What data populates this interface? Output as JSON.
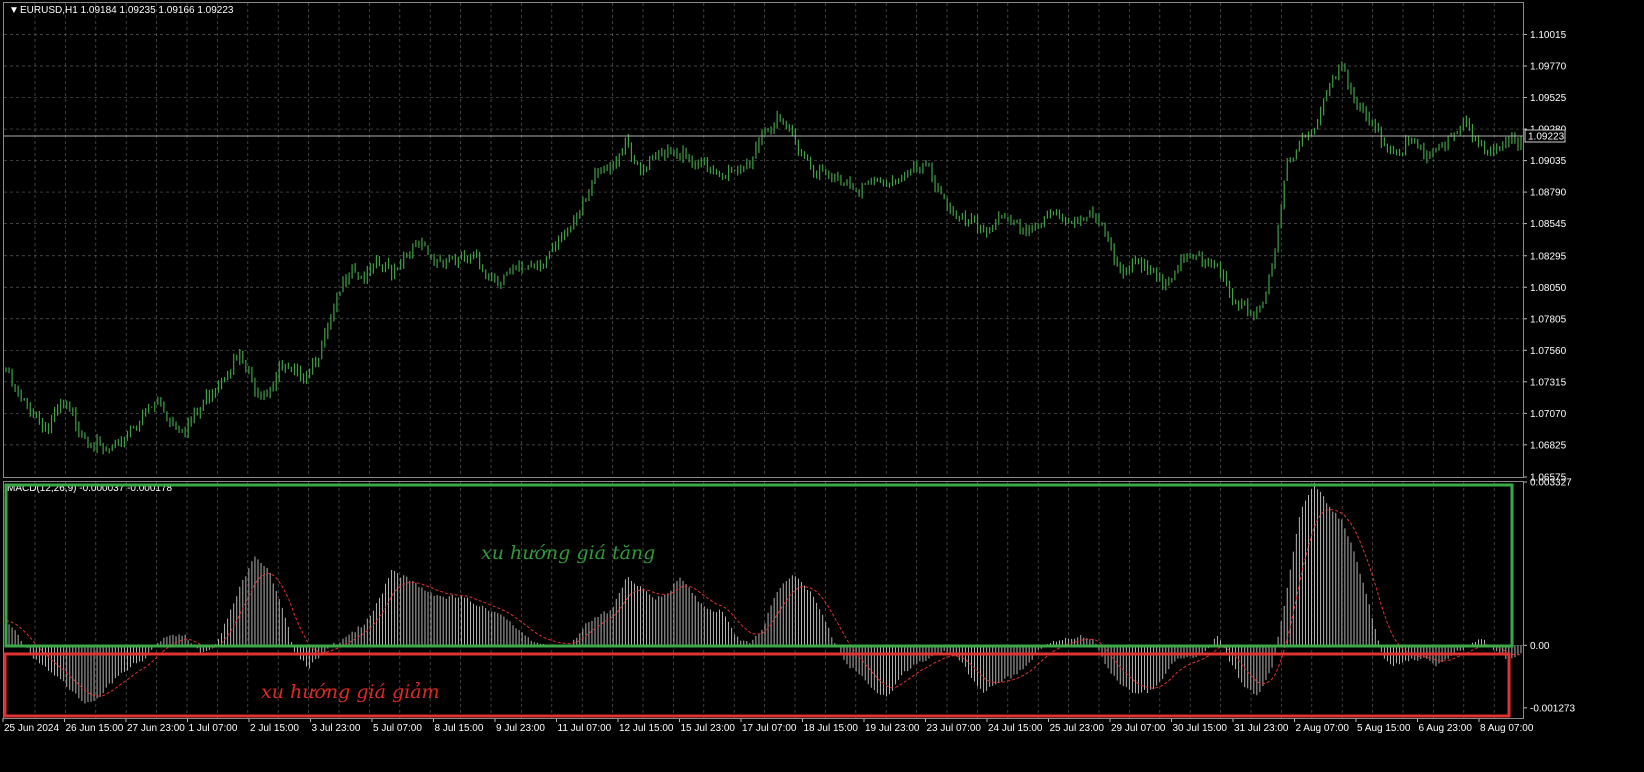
{
  "symbol_header": "EURUSD,H1  1.09184 1.09235 1.09166 1.09223",
  "current_price_label": "1.09223",
  "macd_header": "MACD(12,26,9) -0.000037 -0.000178",
  "annotations": {
    "up_label": "xu hướng giá tăng",
    "down_label": "xu hướng giá giảm"
  },
  "colors": {
    "background": "#000000",
    "candles": "#3fa046",
    "macd_hist": "#c8c8c8",
    "signal": "#e03030",
    "up_box": "#3aa848",
    "down_box": "#e03232",
    "grid": "#5a5a5a"
  },
  "chart_data": [
    {
      "type": "line",
      "name": "EURUSD,H1",
      "grid": true,
      "ylim": [
        1.06575,
        1.1026
      ],
      "y_ticks": [
        "1.10015",
        "1.09770",
        "1.09525",
        "1.09280",
        "1.09035",
        "1.08790",
        "1.08545",
        "1.08295",
        "1.08050",
        "1.07805",
        "1.07560",
        "1.07315",
        "1.07070",
        "1.06825",
        "1.06575"
      ],
      "x_ticks": [
        "25 Jun 2024",
        "26 Jun 15:00",
        "27 Jun 23:00",
        "1 Jul 07:00",
        "2 Jul 15:00",
        "3 Jul 23:00",
        "5 Jul 07:00",
        "8 Jul 15:00",
        "9 Jul 23:00",
        "11 Jul 07:00",
        "12 Jul 15:00",
        "15 Jul 23:00",
        "17 Jul 07:00",
        "18 Jul 15:00",
        "19 Jul 23:00",
        "23 Jul 07:00",
        "24 Jul 15:00",
        "25 Jul 23:00",
        "29 Jul 07:00",
        "30 Jul 15:00",
        "31 Jul 23:00",
        "2 Aug 07:00",
        "5 Aug 15:00",
        "6 Aug 23:00",
        "8 Aug 07:00"
      ],
      "close_path": [
        1.0742,
        1.072,
        1.0712,
        1.0698,
        1.0715,
        1.0705,
        1.069,
        1.068,
        1.068,
        1.07,
        1.0708,
        1.0718,
        1.0705,
        1.07,
        1.071,
        1.073,
        1.0745,
        1.0752,
        1.0732,
        1.0728,
        1.0745,
        1.0738,
        1.0746,
        1.0762,
        1.0795,
        1.0827,
        1.0815,
        1.0825,
        1.082,
        1.0835,
        1.084,
        1.0828,
        1.0832,
        1.0828,
        1.083,
        1.0818,
        1.0815,
        1.082,
        1.0825,
        1.083,
        1.0838,
        1.0856,
        1.088,
        1.0895,
        1.09,
        1.0925,
        1.0895,
        1.0905,
        1.0918,
        1.0912,
        1.09,
        1.0902,
        1.0898,
        1.0895,
        1.0905,
        1.0932,
        1.0935,
        1.0928,
        1.091,
        1.0898,
        1.089,
        1.0892,
        1.0885,
        1.0888,
        1.089,
        1.0895,
        1.0898,
        1.09,
        1.088,
        1.086,
        1.0858,
        1.0852,
        1.086,
        1.0856,
        1.0853,
        1.0858,
        1.0863,
        1.086,
        1.0864,
        1.0862,
        1.0845,
        1.0822,
        1.0825,
        1.0818,
        1.0815,
        1.0822,
        1.083,
        1.0832,
        1.0826,
        1.0795,
        1.079,
        1.0792,
        1.082,
        1.0905,
        1.0925,
        1.093,
        1.096,
        1.0985,
        1.095,
        1.0935,
        1.092,
        1.0915,
        1.092,
        1.091,
        1.0918,
        1.0922,
        1.0935,
        1.092,
        1.0912,
        1.0918,
        1.0922
      ]
    },
    {
      "type": "bar",
      "name": "MACD(12,26,9)",
      "ylim": [
        -0.00148,
        0.003327
      ],
      "y_ticks": [
        "0.003327",
        "0.00",
        "-0.001273"
      ],
      "main": -3.7e-05,
      "signal": -0.000178,
      "macd_path": [
        0.0005,
        0.0002,
        -0.0002,
        -0.0005,
        -0.0007,
        -0.0009,
        -0.0012,
        -0.001,
        -0.0006,
        -0.0004,
        -0.0003,
        0.0001,
        0.0003,
        0.0002,
        -0.0001,
        0.0,
        0.0005,
        0.0012,
        0.0019,
        0.0016,
        0.0008,
        -0.0001,
        -0.0004,
        -0.0002,
        0.0001,
        0.0003,
        0.0004,
        0.0009,
        0.0016,
        0.0014,
        0.0012,
        0.0011,
        0.001,
        0.001,
        0.0009,
        0.0008,
        0.0006,
        0.0004,
        0.0002,
        0.0,
        0.0,
        0.0001,
        0.0004,
        0.0006,
        0.0008,
        0.0014,
        0.0012,
        0.001,
        0.0011,
        0.0014,
        0.001,
        0.0008,
        0.0007,
        0.0002,
        0.0001,
        0.0004,
        0.0011,
        0.0015,
        0.0013,
        0.0008,
        0.0002,
        -0.0003,
        -0.0006,
        -0.0009,
        -0.001,
        -0.0006,
        -0.0004,
        -0.0002,
        -0.0001,
        -0.0002,
        -0.0006,
        -0.0009,
        -0.0008,
        -0.0006,
        -0.0004,
        -0.0001,
        0.0001,
        0.0002,
        0.0002,
        0.0001,
        -0.0004,
        -0.0008,
        -0.001,
        -0.0009,
        -0.0006,
        -0.0003,
        -0.0002,
        -0.0001,
        0.0002,
        -0.0004,
        -0.0008,
        -0.001,
        -0.0004,
        0.0012,
        0.0028,
        0.0033,
        0.0029,
        0.0026,
        0.0018,
        0.0008,
        -0.0002,
        -0.0004,
        -0.0003,
        -0.0002,
        -0.0004,
        -0.0002,
        0.0,
        0.0002,
        -0.0001,
        -0.0003,
        -0.0001
      ]
    }
  ]
}
